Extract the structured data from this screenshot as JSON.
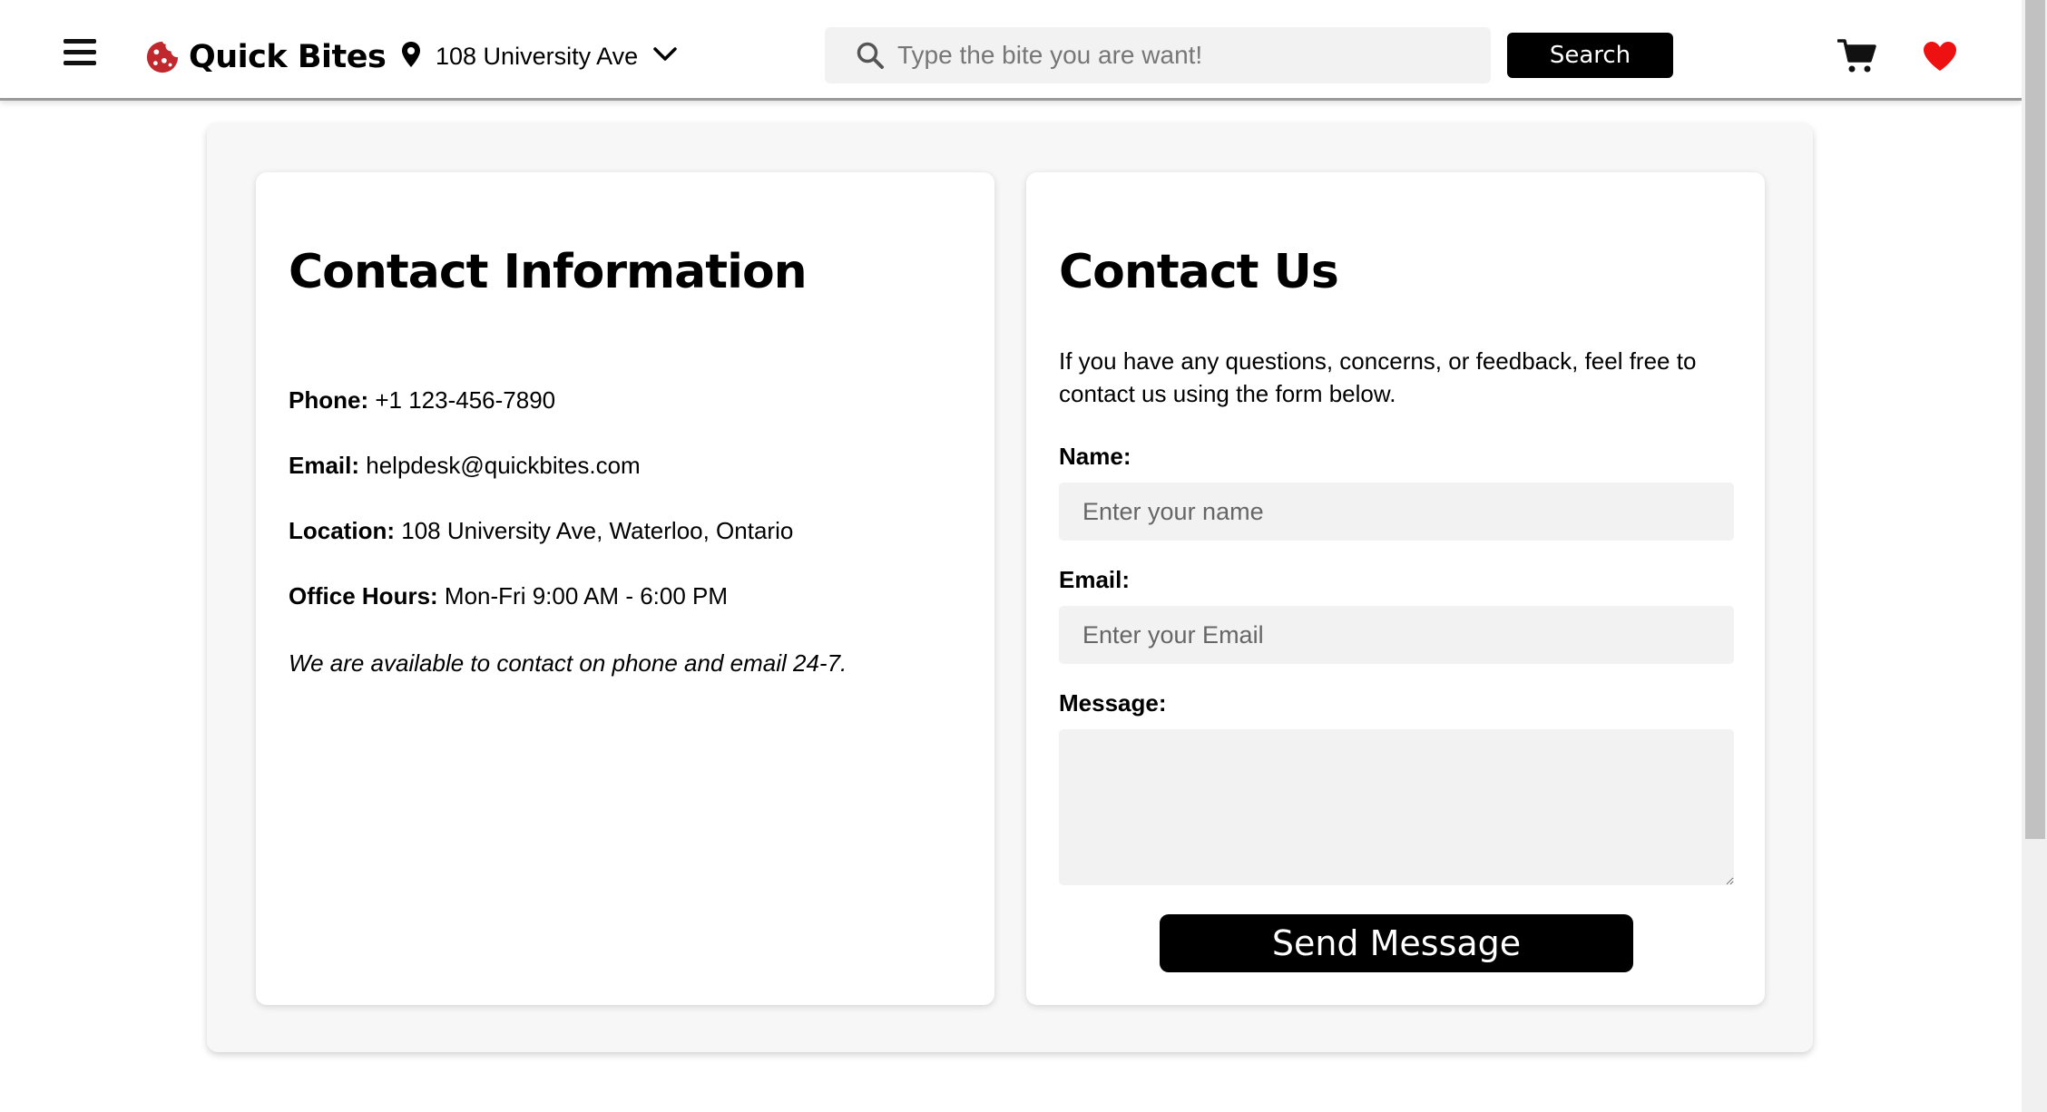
{
  "header": {
    "brand": "Quick Bites",
    "location": "108 University Ave",
    "search_placeholder": "Type the bite you are want!",
    "search_button": "Search"
  },
  "colors": {
    "accent": "#c0282d",
    "heart": "#ee1111",
    "button_bg": "#000000",
    "field_bg": "#f2f2f2"
  },
  "icons": {
    "menu": "menu-icon",
    "logo": "cookie-icon",
    "location": "map-pin-icon",
    "dropdown": "chevron-down-icon",
    "search": "search-icon",
    "cart": "cart-icon",
    "favorites": "heart-icon"
  },
  "contact_info": {
    "title": "Contact Information",
    "phone_label": "Phone:",
    "phone": "+1 123-456-7890",
    "email_label": "Email:",
    "email": "helpdesk@quickbites.com",
    "location_label": "Location:",
    "location": "108 University Ave, Waterloo, Ontario",
    "hours_label": "Office Hours:",
    "hours": "Mon-Fri 9:00 AM - 6:00 PM",
    "note": "We are available to contact on phone and email 24-7."
  },
  "contact_form": {
    "title": "Contact Us",
    "intro": "If you have any questions, concerns, or feedback, feel free to contact us using the form below.",
    "name_label": "Name:",
    "name_placeholder": "Enter your name",
    "email_label": "Email:",
    "email_placeholder": "Enter your Email",
    "message_label": "Message:",
    "message_placeholder": "",
    "submit": "Send Message"
  }
}
